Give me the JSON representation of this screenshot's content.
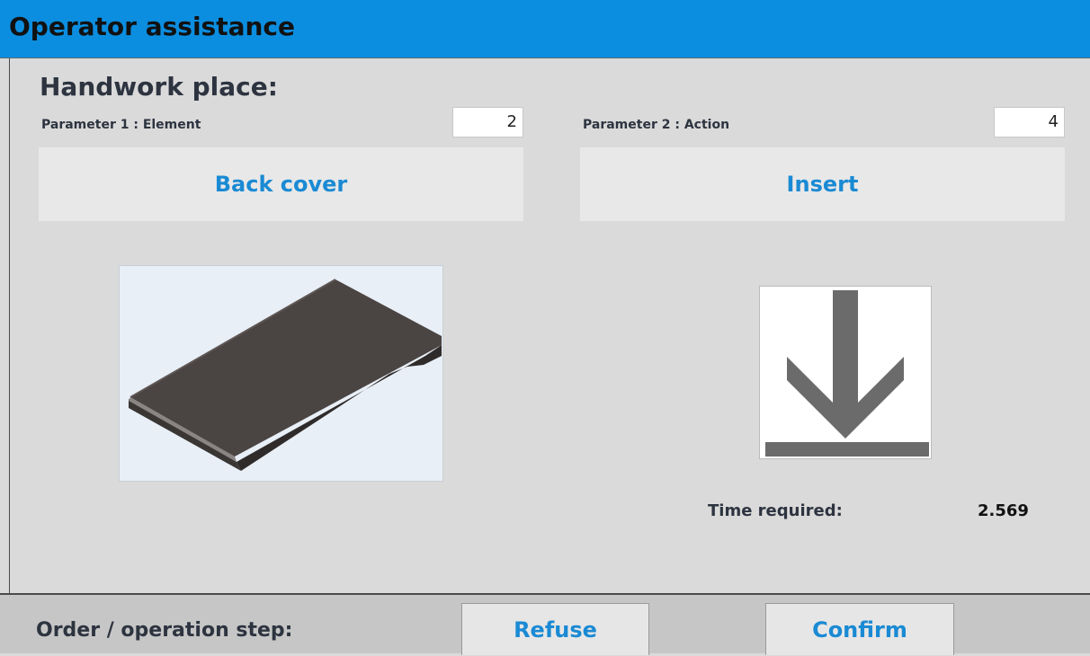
{
  "window": {
    "title": "Operator assistance"
  },
  "main": {
    "heading": "Handwork place:",
    "param1": {
      "label": "Parameter 1 : Element",
      "value": "2",
      "name": "Back cover"
    },
    "param2": {
      "label": "Parameter 2 : Action",
      "value": "4",
      "name": "Insert"
    },
    "icons": {
      "element": "back-cover-part-image",
      "action": "insert-down-arrow-icon"
    },
    "time": {
      "label": "Time required:",
      "value": "2.569"
    }
  },
  "footer": {
    "step_label": "Order / operation step:",
    "refuse_label": "Refuse",
    "confirm_label": "Confirm"
  },
  "colors": {
    "titlebar": "#0c8ee0",
    "accent_text": "#1a8ad4",
    "background": "#dadada"
  }
}
